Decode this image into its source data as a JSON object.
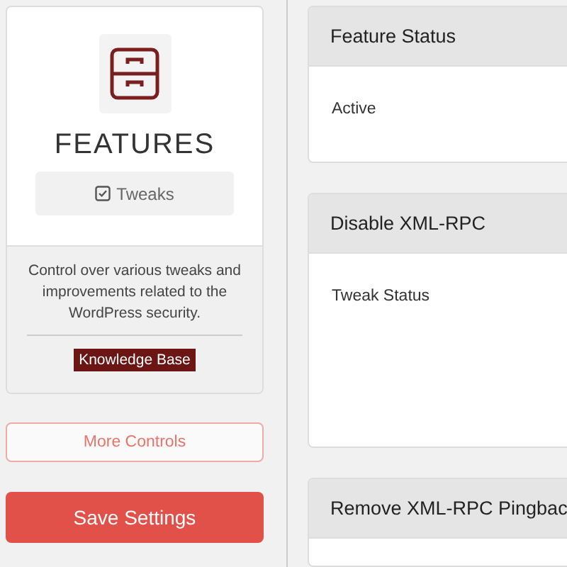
{
  "sidebar": {
    "title": "FEATURES",
    "tab": {
      "label": "Tweaks",
      "selected": true
    },
    "description": "Control over various tweaks and improvements related to the WordPress security.",
    "link": "Knowledge Base",
    "more_button": "More Controls",
    "save_button": "Save Settings"
  },
  "panels": [
    {
      "title": "Feature Status",
      "body": "Active",
      "kind": "short"
    },
    {
      "title": "Disable XML-RPC",
      "body": "Tweak Status",
      "kind": "tall"
    },
    {
      "title": "Remove XML-RPC Pingbac",
      "kind": "cut"
    }
  ]
}
